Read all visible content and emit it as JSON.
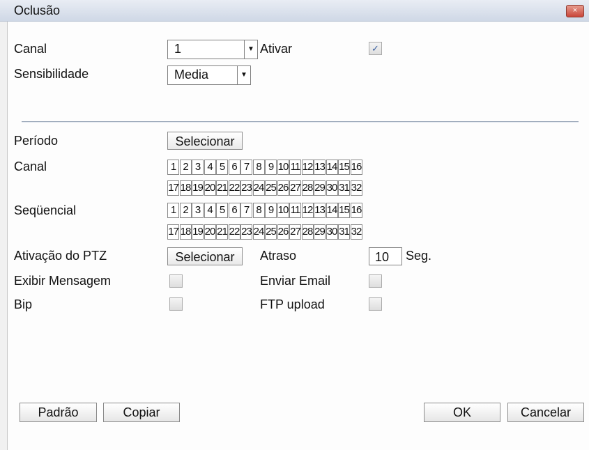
{
  "window": {
    "title": "Oclusão",
    "close_glyph": "×"
  },
  "form": {
    "canal": {
      "label": "Canal",
      "value": "1"
    },
    "ativar": {
      "label": "Ativar",
      "checked": true
    },
    "sensibilidade": {
      "label": "Sensibilidade",
      "value": "Media"
    },
    "periodo": {
      "label": "Período",
      "button": "Selecionar"
    },
    "canal_grid": {
      "label": "Canal"
    },
    "sequencial": {
      "label": "Seqüencial"
    },
    "ptz": {
      "label": "Ativação do PTZ",
      "button": "Selecionar"
    },
    "atraso": {
      "label": "Atraso",
      "value": "10",
      "unit": "Seg."
    },
    "exibir_mensagem": {
      "label": "Exibir Mensagem",
      "checked": false
    },
    "enviar_email": {
      "label": "Enviar Email",
      "checked": false
    },
    "bip": {
      "label": "Bip",
      "checked": false
    },
    "ftp_upload": {
      "label": "FTP upload",
      "checked": false
    }
  },
  "grid_numbers": {
    "row1": [
      "1",
      "2",
      "3",
      "4",
      "5",
      "6",
      "7",
      "8",
      "9",
      "10",
      "11",
      "12",
      "13",
      "14",
      "15",
      "16"
    ],
    "row2": [
      "17",
      "18",
      "19",
      "20",
      "21",
      "22",
      "23",
      "24",
      "25",
      "26",
      "27",
      "28",
      "29",
      "30",
      "31",
      "32"
    ]
  },
  "footer": {
    "padrao": "Padrão",
    "copiar": "Copiar",
    "ok": "OK",
    "cancelar": "Cancelar"
  },
  "icons": {
    "dropdown": "▼",
    "check": "✓"
  }
}
